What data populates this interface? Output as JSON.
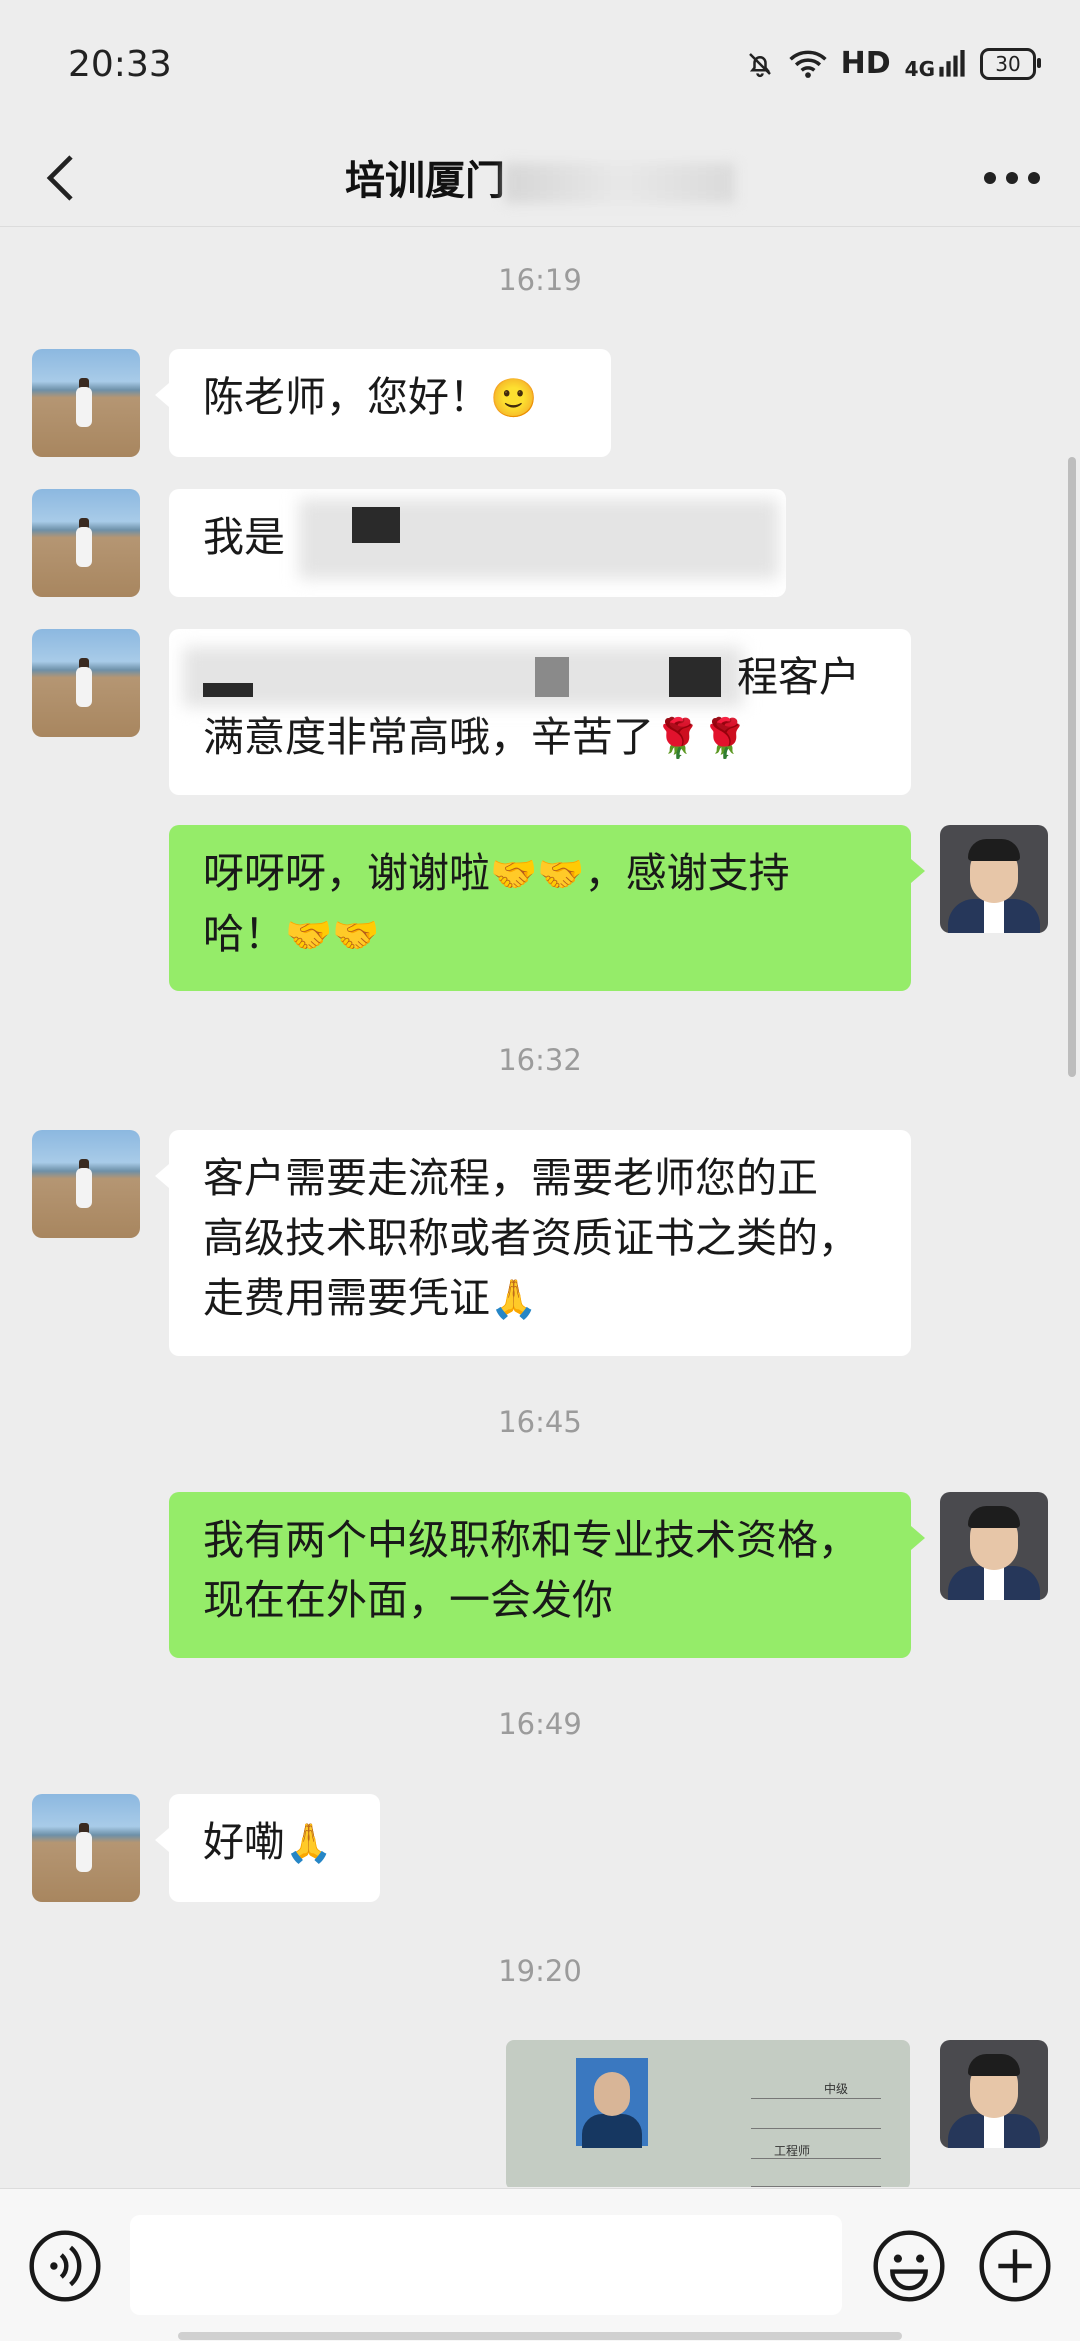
{
  "status_bar": {
    "time": "20:33",
    "hd": "HD",
    "network": "4G",
    "battery": "30"
  },
  "nav": {
    "title_visible": "培训厦门"
  },
  "messages": [
    {
      "type": "timestamp",
      "text": "16:19"
    },
    {
      "type": "incoming",
      "text": "陈老师，您好！",
      "emoji": "🙂"
    },
    {
      "type": "incoming",
      "text": "我是"
    },
    {
      "type": "incoming",
      "text_line1_tail": "程客户",
      "text_line2": "满意度非常高哦，辛苦了",
      "emoji": "🌹🌹"
    },
    {
      "type": "outgoing",
      "text_a": "呀呀呀，谢谢啦",
      "emoji_a": "🤝🤝",
      "text_b": "，感谢支持",
      "text_c": "哈！",
      "emoji_c": "🤝🤝"
    },
    {
      "type": "timestamp",
      "text": "16:32"
    },
    {
      "type": "incoming",
      "line1": "客户需要走流程，需要老师您的正",
      "line2": "高级技术职称或者资质证书之类的，",
      "line3": "走费用需要凭证",
      "emoji": "🙏"
    },
    {
      "type": "timestamp",
      "text": "16:45"
    },
    {
      "type": "outgoing",
      "line1": "我有两个中级职称和专业技术资格，",
      "line2": "现在在外面，一会发你"
    },
    {
      "type": "timestamp",
      "text": "16:49"
    },
    {
      "type": "incoming",
      "text": "好嘞",
      "emoji": "🙏"
    },
    {
      "type": "timestamp",
      "text": "19:20"
    },
    {
      "type": "outgoing-image",
      "cert_level": "中级",
      "cert_title": "工程师"
    }
  ],
  "input": {
    "placeholder": ""
  },
  "icons": {
    "back": "chevron-left-icon",
    "more": "more-dots-icon",
    "voice": "voice-icon",
    "emoji": "emoji-icon",
    "plus": "plus-icon"
  }
}
